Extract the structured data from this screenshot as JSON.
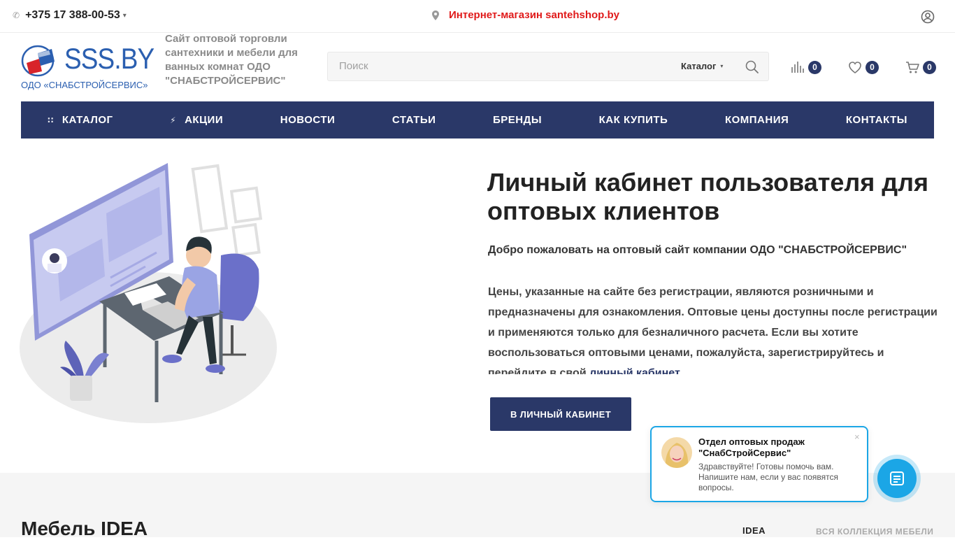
{
  "topbar": {
    "phone": "+375 17 388-00-53",
    "promo": "Интернет-магазин santehshop.by"
  },
  "logo": {
    "text": "SSS.BY",
    "subtitle": "ОДО «СНАБСТРОЙСЕРВИС»"
  },
  "tagline": "Сайт оптовой торговли сантехники и мебели для ванных комнат ОДО \"СНАБСТРОЙСЕРВИС\"",
  "search": {
    "placeholder": "Поиск",
    "category": "Каталог"
  },
  "header_counters": {
    "compare": "0",
    "favorites": "0",
    "cart": "0"
  },
  "nav": {
    "items": [
      {
        "label": "КАТАЛОГ"
      },
      {
        "label": "АКЦИИ"
      },
      {
        "label": "НОВОСТИ"
      },
      {
        "label": "СТАТЬИ"
      },
      {
        "label": "БРЕНДЫ"
      },
      {
        "label": "КАК КУПИТЬ"
      },
      {
        "label": "КОМПАНИЯ"
      },
      {
        "label": "КОНТАКТЫ"
      }
    ]
  },
  "hero": {
    "title": "Личный кабинет пользователя для оптовых клиентов",
    "welcome": "Добро пожаловать на оптовый сайт компании ОДО \"СНАБСТРОЙСЕРВИС\"",
    "text": "Цены, указанные на сайте без регистрации, являются розничными и предназначены для ознакомления. Оптовые цены доступны после регистрации и применяются только для безналичного расчета. Если вы хотите воспользоваться оптовыми ценами, пожалуйста, зарегистрируйтесь и перейдите в свой",
    "link": "личный кабинет",
    "button": "В ЛИЧНЫЙ КАБИНЕТ"
  },
  "section": {
    "title": "Мебель IDEA",
    "tab_active": "IDEA",
    "tab_all": "ВСЯ КОЛЛЕКЦИЯ МЕБЕЛИ"
  },
  "chat": {
    "title": "Отдел оптовых продаж \"СнабСтройСервис\"",
    "message": "Здравствуйте! Готовы помочь вам. Напишите нам, если у вас появятся вопросы.",
    "close": "×"
  },
  "colors": {
    "brand_navy": "#2a3868",
    "promo_red": "#e01a1a",
    "logo_blue": "#2b5fb0",
    "chat_blue": "#1ba6e6"
  }
}
